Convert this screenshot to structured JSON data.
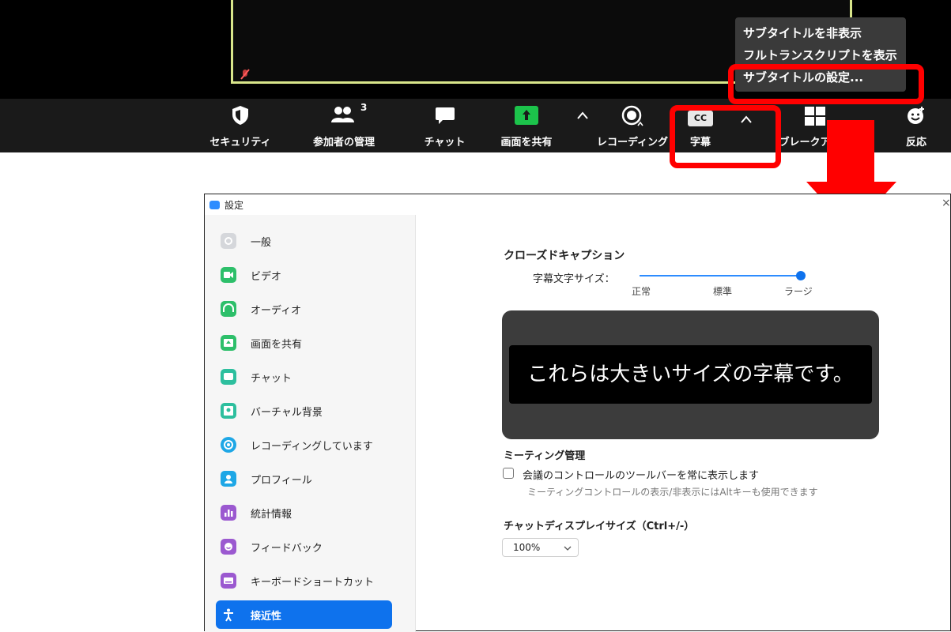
{
  "toolbar": {
    "items": [
      {
        "label": "セキュリティ",
        "icon": "shield-icon"
      },
      {
        "label": "参加者の管理",
        "icon": "participants-icon",
        "badge": "3"
      },
      {
        "label": "チャット",
        "icon": "chat-icon"
      },
      {
        "label": "画面を共有",
        "icon": "share-screen-icon"
      },
      {
        "label": "レコーディング",
        "icon": "record-icon"
      },
      {
        "label": "字幕",
        "icon": "cc-icon",
        "icon_text": "CC"
      },
      {
        "label": "ブレークアウト",
        "icon": "breakout-icon"
      },
      {
        "label": "反応",
        "icon": "reaction-icon"
      }
    ]
  },
  "caption_menu": {
    "items": [
      "サブタイトルを非表示",
      "フルトランスクリプトを表示",
      "サブタイトルの設定..."
    ]
  },
  "settings": {
    "title": "設定",
    "sidebar": [
      {
        "label": "一般",
        "icon": "gear-icon",
        "color": "#9aa0a6"
      },
      {
        "label": "ビデオ",
        "icon": "video-icon",
        "color": "#2dbf6a"
      },
      {
        "label": "オーディオ",
        "icon": "headphones-icon",
        "color": "#2dbf6a"
      },
      {
        "label": "画面を共有",
        "icon": "share-screen-icon",
        "color": "#2dbf6a"
      },
      {
        "label": "チャット",
        "icon": "chat-icon",
        "color": "#2dbf9e"
      },
      {
        "label": "バーチャル背景",
        "icon": "person-icon",
        "color": "#2dbf9e"
      },
      {
        "label": "レコーディングしています",
        "icon": "record-icon",
        "color": "#1ea7e6"
      },
      {
        "label": "プロフィール",
        "icon": "profile-icon",
        "color": "#1ea7e6"
      },
      {
        "label": "統計情報",
        "icon": "stats-icon",
        "color": "#9b59d0"
      },
      {
        "label": "フィードバック",
        "icon": "smile-icon",
        "color": "#9b59d0"
      },
      {
        "label": "キーボードショートカット",
        "icon": "keyboard-icon",
        "color": "#9b59d0"
      },
      {
        "label": "接近性",
        "icon": "accessibility-icon",
        "active": true
      }
    ],
    "closed_caption": {
      "heading": "クローズドキャプション",
      "size_label": "字幕文字サイズ：",
      "size_options": [
        "正常",
        "標準",
        "ラージ"
      ],
      "size_level": "ラージ",
      "preview_text": "これらは大きいサイズの字幕です。"
    },
    "meeting": {
      "heading": "ミーティング管理",
      "checkbox_label": "会議のコントロールのツールバーを常に表示します",
      "checked": false,
      "hint": "ミーティングコントロールの表示/非表示にはAltキーも使用できます"
    },
    "chat_size": {
      "heading": "チャットディスプレイサイズ（Ctrl+/-）",
      "value": "100%"
    }
  },
  "colors": {
    "accent": "#0e72ed",
    "highlight": "#ff0000"
  }
}
